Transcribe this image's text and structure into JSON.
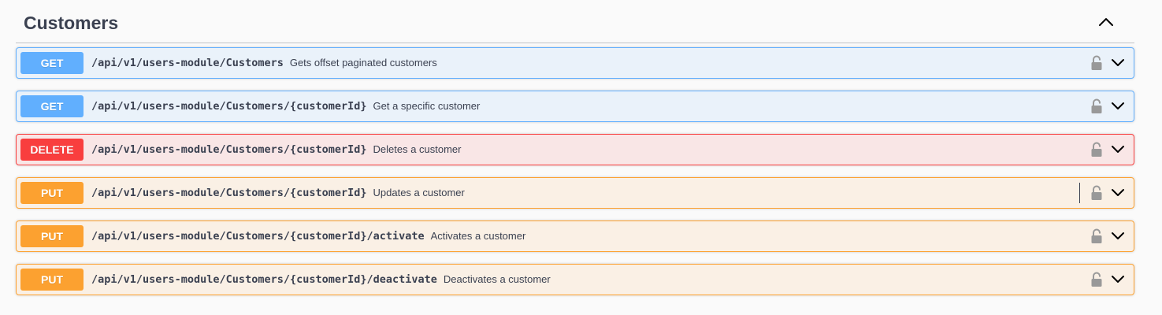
{
  "section": {
    "title": "Customers"
  },
  "operations": [
    {
      "method": "GET",
      "path": "/api/v1/users-module/Customers",
      "summary": "Gets offset paginated customers"
    },
    {
      "method": "GET",
      "path": "/api/v1/users-module/Customers/{customerId}",
      "summary": "Get a specific customer"
    },
    {
      "method": "DELETE",
      "path": "/api/v1/users-module/Customers/{customerId}",
      "summary": "Deletes a customer"
    },
    {
      "method": "PUT",
      "path": "/api/v1/users-module/Customers/{customerId}",
      "summary": "Updates a customer"
    },
    {
      "method": "PUT",
      "path": "/api/v1/users-module/Customers/{customerId}/activate",
      "summary": "Activates a customer"
    },
    {
      "method": "PUT",
      "path": "/api/v1/users-module/Customers/{customerId}/deactivate",
      "summary": "Deactivates a customer"
    }
  ],
  "icons": {
    "collapse": "chevron-up-icon",
    "lock": "lock-icon",
    "expand": "chevron-down-icon"
  },
  "colors": {
    "get": "#61affe",
    "delete": "#f93e3e",
    "put": "#fca130",
    "text": "#3b4151"
  }
}
